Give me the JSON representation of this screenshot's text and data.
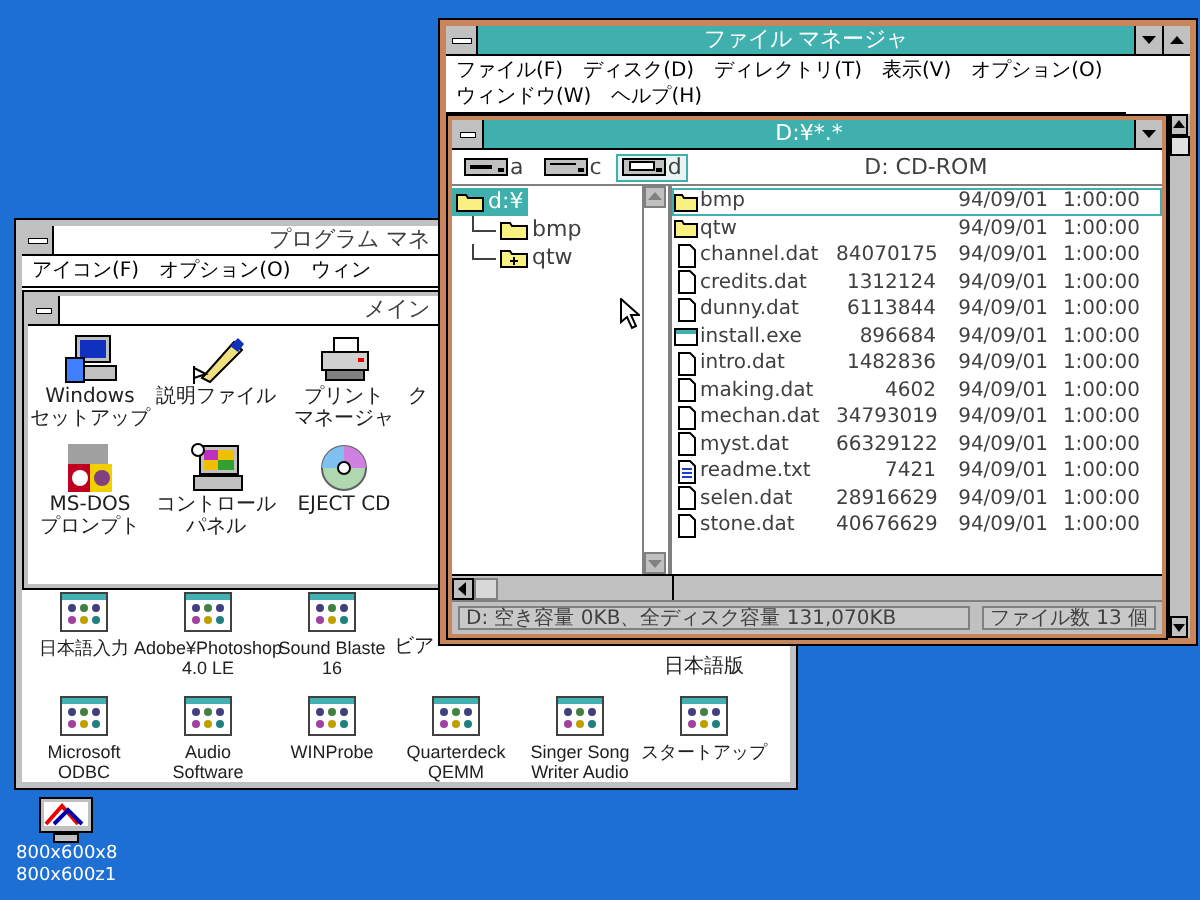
{
  "desktop_icon": {
    "label": "800x600x8\n800x600z1"
  },
  "program_manager": {
    "title": "プログラム マネ",
    "menu": [
      "アイコン(F)",
      "オプション(O)",
      "ウィン"
    ],
    "group_window": {
      "title": "メイン",
      "items": [
        {
          "kind": "setup",
          "label": "Windows\nセットアップ"
        },
        {
          "kind": "readme",
          "label": "説明ファイル"
        },
        {
          "kind": "printer",
          "lines": [
            "プリント",
            "マネージャ"
          ]
        },
        {
          "kind": "covered",
          "label": "ク"
        },
        {
          "kind": "msdos",
          "label": "MS-DOS\nプロンプト"
        },
        {
          "kind": "control",
          "lines": [
            "コントロール",
            "パネル"
          ]
        },
        {
          "kind": "cd",
          "label": "EJECT CD"
        }
      ]
    },
    "group_icons": [
      {
        "kind": "group",
        "label": "日本語入力"
      },
      {
        "kind": "group",
        "label": "Adobe¥Photoshop\n4.0 LE"
      },
      {
        "kind": "group",
        "label": "Sound Blaste\n16"
      },
      {
        "kind": "covered_icon",
        "label": "ビア"
      },
      {
        "kind": "covered_top",
        "label": "日本語版"
      },
      {
        "kind": "group",
        "label": "Microsoft\nODBC"
      },
      {
        "kind": "group",
        "label": "Audio\nSoftware"
      },
      {
        "kind": "group",
        "label": "WINProbe"
      },
      {
        "kind": "group",
        "label": "Quarterdeck\nQEMM"
      },
      {
        "kind": "group",
        "label": "Singer Song\nWriter Audio"
      },
      {
        "kind": "group",
        "label": "スタートアップ"
      }
    ]
  },
  "file_manager": {
    "title": "ファイル マネージャ",
    "menu": [
      "ファイル(F)",
      "ディスク(D)",
      "ディレクトリ(T)",
      "表示(V)",
      "オプション(O)",
      "ウィンドウ(W)",
      "ヘルプ(H)"
    ],
    "directory_window": {
      "title": "D:¥*.*",
      "drives": [
        {
          "letter": "a",
          "kind": "floppy",
          "selected": false
        },
        {
          "letter": "c",
          "kind": "hdd",
          "selected": false
        },
        {
          "letter": "d",
          "kind": "cdrom",
          "selected": true
        }
      ],
      "volume": "D: CD-ROM",
      "tree": [
        {
          "label": "d:¥",
          "selected": true,
          "expandable": false,
          "children": [
            {
              "label": "bmp",
              "selected": false,
              "expandable": false
            },
            {
              "label": "qtw",
              "selected": false,
              "expandable": true
            }
          ]
        }
      ],
      "files": [
        {
          "kind": "folder",
          "name": "bmp",
          "date": "94/09/01",
          "time": "1:00:00",
          "selected": true
        },
        {
          "kind": "folder",
          "name": "qtw",
          "date": "94/09/01",
          "time": "1:00:00",
          "selected": false
        },
        {
          "kind": "file",
          "name": "channel.dat",
          "size": "84070175",
          "date": "94/09/01",
          "time": "1:00:00",
          "selected": false
        },
        {
          "kind": "file",
          "name": "credits.dat",
          "size": "1312124",
          "date": "94/09/01",
          "time": "1:00:00",
          "selected": false
        },
        {
          "kind": "file",
          "name": "dunny.dat",
          "size": "6113844",
          "date": "94/09/01",
          "time": "1:00:00",
          "selected": false
        },
        {
          "kind": "exe",
          "name": "install.exe",
          "size": "896684",
          "date": "94/09/01",
          "time": "1:00:00",
          "selected": false
        },
        {
          "kind": "file",
          "name": "intro.dat",
          "size": "1482836",
          "date": "94/09/01",
          "time": "1:00:00",
          "selected": false
        },
        {
          "kind": "file",
          "name": "making.dat",
          "size": "4602",
          "date": "94/09/01",
          "time": "1:00:00",
          "selected": false
        },
        {
          "kind": "file",
          "name": "mechan.dat",
          "size": "34793019",
          "date": "94/09/01",
          "time": "1:00:00",
          "selected": false
        },
        {
          "kind": "file",
          "name": "myst.dat",
          "size": "66329122",
          "date": "94/09/01",
          "time": "1:00:00",
          "selected": false
        },
        {
          "kind": "text",
          "name": "readme.txt",
          "size": "7421",
          "date": "94/09/01",
          "time": "1:00:00",
          "selected": false
        },
        {
          "kind": "file",
          "name": "selen.dat",
          "size": "28916629",
          "date": "94/09/01",
          "time": "1:00:00",
          "selected": false
        },
        {
          "kind": "file",
          "name": "stone.dat",
          "size": "40676629",
          "date": "94/09/01",
          "time": "1:00:00",
          "selected": false
        }
      ],
      "status_left": "D: 空き容量 0KB、全ディスク容量 131,070KB",
      "status_right": "ファイル数 13 個"
    }
  }
}
